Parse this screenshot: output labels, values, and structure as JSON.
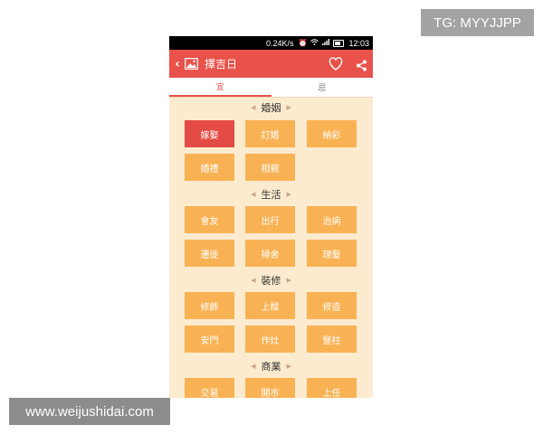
{
  "watermarks": {
    "top_right": "TG: MYYJJPP",
    "bottom_left": "www.weijushidai.com"
  },
  "statusbar": {
    "speed": "0.24K/s",
    "time": "12:03",
    "icons": [
      "alarm-icon",
      "wifi-icon",
      "signal-icon",
      "battery-icon"
    ]
  },
  "appbar": {
    "title": "擇吉日",
    "back_icon": "chevron-left-icon",
    "app_icon": "image-icon",
    "favorite_icon": "heart-icon",
    "share_icon": "share-icon",
    "color": "#e8524a"
  },
  "tabs": [
    {
      "label": "宜",
      "active": true
    },
    {
      "label": "忌",
      "active": false
    }
  ],
  "sections": [
    {
      "title": "婚姻",
      "items": [
        "嫁娶",
        "訂婚",
        "納彩",
        "婚禮",
        "相親"
      ]
    },
    {
      "title": "生活",
      "items": [
        "會友",
        "出行",
        "治病",
        "遷徙",
        "掃舍",
        "理髮"
      ]
    },
    {
      "title": "裝修",
      "items": [
        "修飾",
        "上樑",
        "修造",
        "安門",
        "作灶",
        "豎柱"
      ]
    },
    {
      "title": "商業",
      "items": [
        "交易",
        "開市",
        "上任"
      ]
    }
  ],
  "selected_item": "嫁娶",
  "colors": {
    "button": "#f9b253",
    "button_selected": "#e54b45",
    "background": "#fcebce"
  }
}
